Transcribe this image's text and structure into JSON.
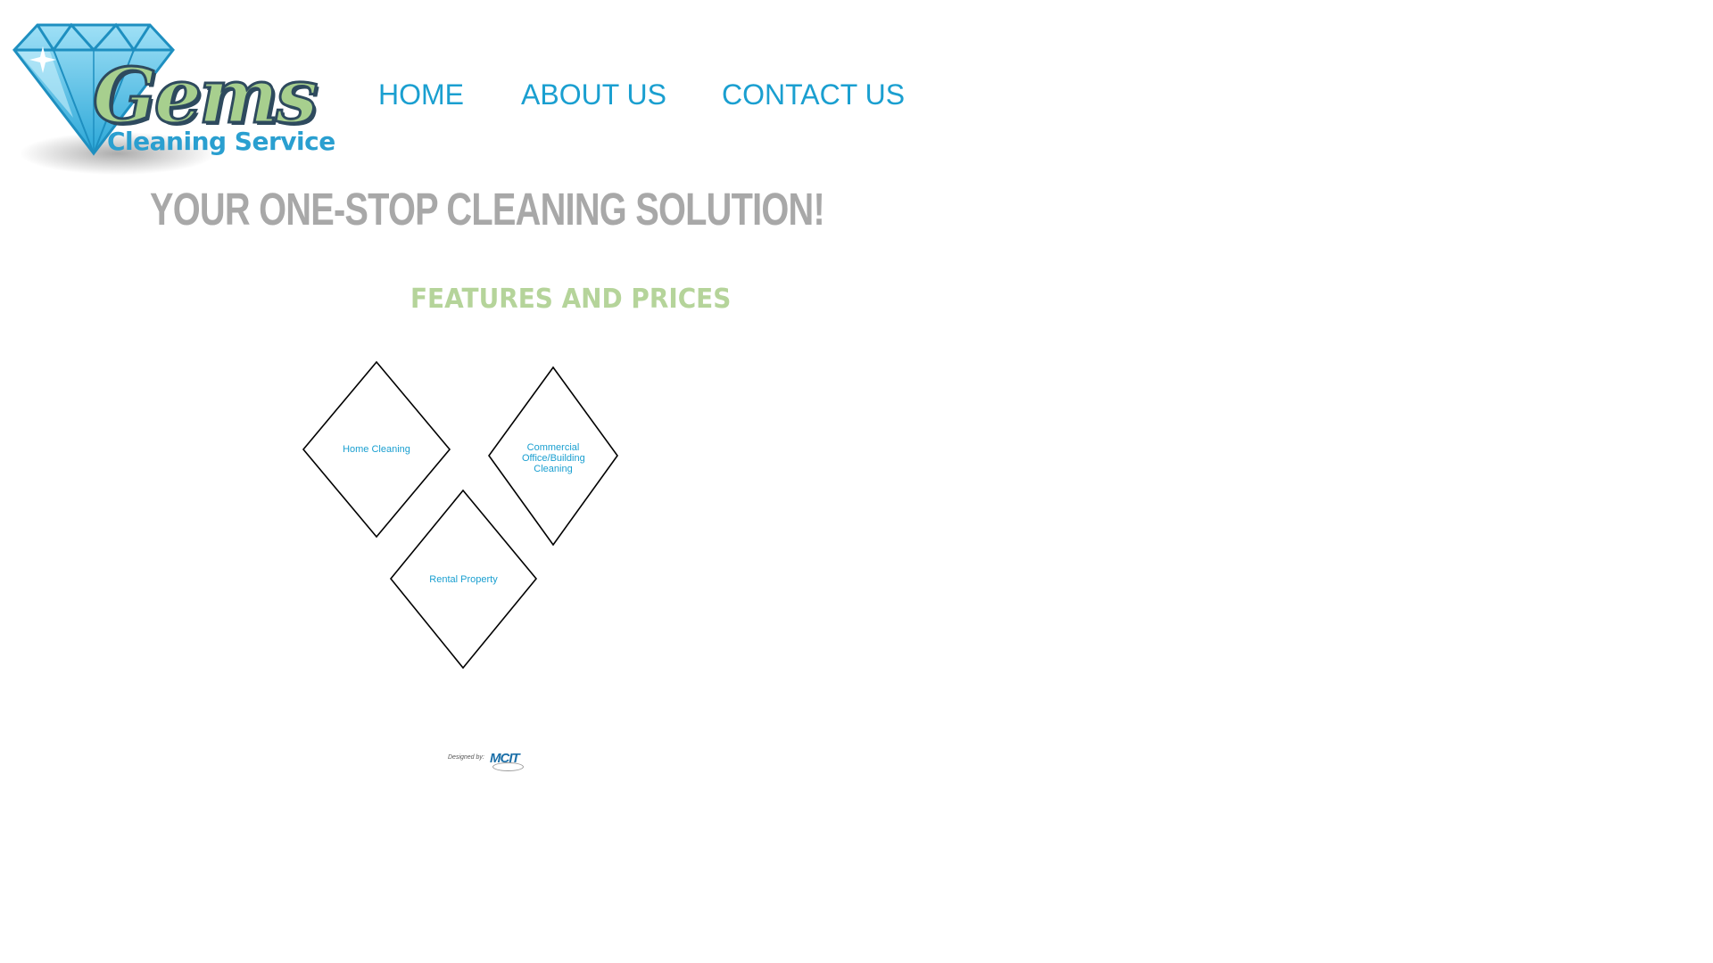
{
  "logo": {
    "brand_name": "Gems",
    "tagline": "Cleaning Service"
  },
  "nav": {
    "items": [
      {
        "label": "HOME"
      },
      {
        "label": "ABOUT US"
      },
      {
        "label": "CONTACT US"
      }
    ]
  },
  "hero": {
    "tagline": "YOUR ONE-STOP CLEANING SOLUTION!"
  },
  "features": {
    "title": "FEATURES AND PRICES",
    "services": [
      {
        "label": "Home Cleaning"
      },
      {
        "label": "Commercial Office/Building Cleaning"
      },
      {
        "label": "Rental Property"
      }
    ]
  },
  "footer": {
    "designed_by_label": "Designed by:",
    "designer_brand": "MCIT"
  },
  "colors": {
    "nav_text": "#1a9fd0",
    "tagline_gray": "#a8a8a8",
    "features_green": "#b5d49a",
    "diamond_stroke": "#000000",
    "diamond_text": "#1a9fd0",
    "logo_gem_blue": "#4cc3ec"
  }
}
